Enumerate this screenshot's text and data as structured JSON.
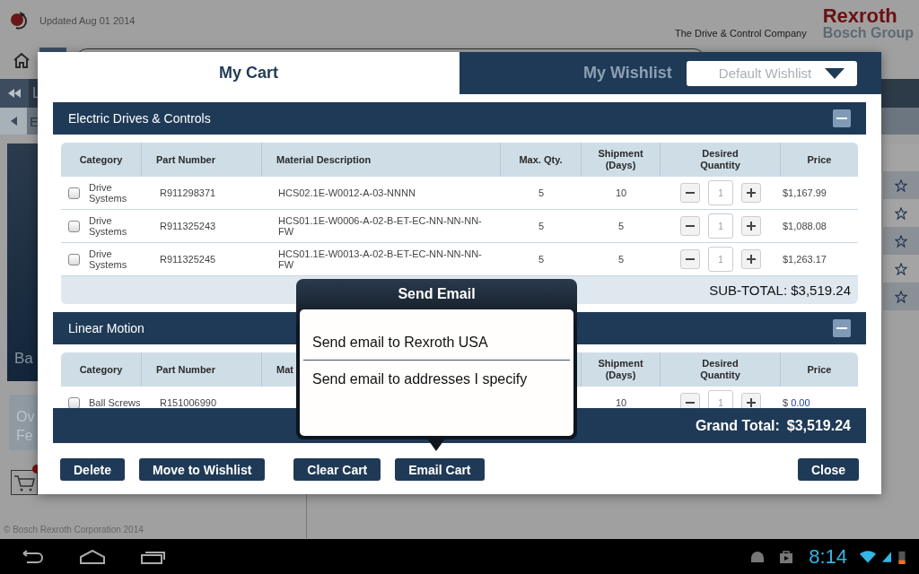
{
  "header": {
    "update_text": "Updated Aug 01 2014",
    "tagline": "The Drive & Control Company",
    "brand_name": "Rexroth",
    "brand_group": "Bosch Group"
  },
  "background": {
    "nav_label": "L",
    "sub_label": "E",
    "tile_label": "Ba",
    "feature_lines": [
      "Ov",
      "Fe"
    ],
    "copyright": "© Bosch Rexroth Corporation 2014"
  },
  "tabs": [
    {
      "label": "My Cart",
      "selected": true
    },
    {
      "label": "My Wishlist",
      "selected": false
    }
  ],
  "wishlist_dropdown": {
    "value": "Default Wishlist"
  },
  "sections": [
    {
      "title": "Electric Drives & Controls",
      "expanded": true,
      "columns": [
        "Category",
        "Part Number",
        "Material Description",
        "Max. Qty.",
        "Shipment (Days)",
        "Desired Quantity",
        "Price"
      ],
      "rows": [
        {
          "checked": false,
          "category": "Drive Systems",
          "part_number": "R911298371",
          "description": "HCS02.1E-W0012-A-03-NNNN",
          "max_qty": "5",
          "shipment": "10",
          "quantity": "1",
          "price": "$1,167.99"
        },
        {
          "checked": false,
          "category": "Drive Systems",
          "part_number": "R911325243",
          "description": "HCS01.1E-W0006-A-02-B-ET-EC-NN-NN-NN-FW",
          "max_qty": "5",
          "shipment": "5",
          "quantity": "1",
          "price": "$1,088.08"
        },
        {
          "checked": false,
          "category": "Drive Systems",
          "part_number": "R911325245",
          "description": "HCS01.1E-W0013-A-02-B-ET-EC-NN-NN-NN-FW",
          "max_qty": "5",
          "shipment": "5",
          "quantity": "1",
          "price": "$1,263.17"
        }
      ],
      "subtotal": "SUB-TOTAL: $3,519.24"
    },
    {
      "title": "Linear Motion",
      "expanded": true,
      "columns": [
        "Category",
        "Part Number",
        "Mat",
        "",
        "Shipment (Days)",
        "Desired Quantity",
        "Price"
      ],
      "rows": [
        {
          "checked": false,
          "category": "Ball Screws",
          "part_number": "R151006990",
          "shipment": "10",
          "quantity": "1",
          "price": "$",
          "price_link": "0.00"
        }
      ]
    }
  ],
  "grand_total": {
    "label": "Grand Total:",
    "value": "$3,519.24"
  },
  "buttons": [
    {
      "label": "Delete"
    },
    {
      "label": "Move to Wishlist"
    },
    {
      "label": "Clear Cart"
    },
    {
      "label": "Email Cart"
    },
    {
      "label": "Close"
    }
  ],
  "popup": {
    "title": "Send Email",
    "options": [
      "Send email to Rexroth USA",
      "Send email to addresses I specify"
    ]
  },
  "system_bar": {
    "time": "8:14"
  }
}
